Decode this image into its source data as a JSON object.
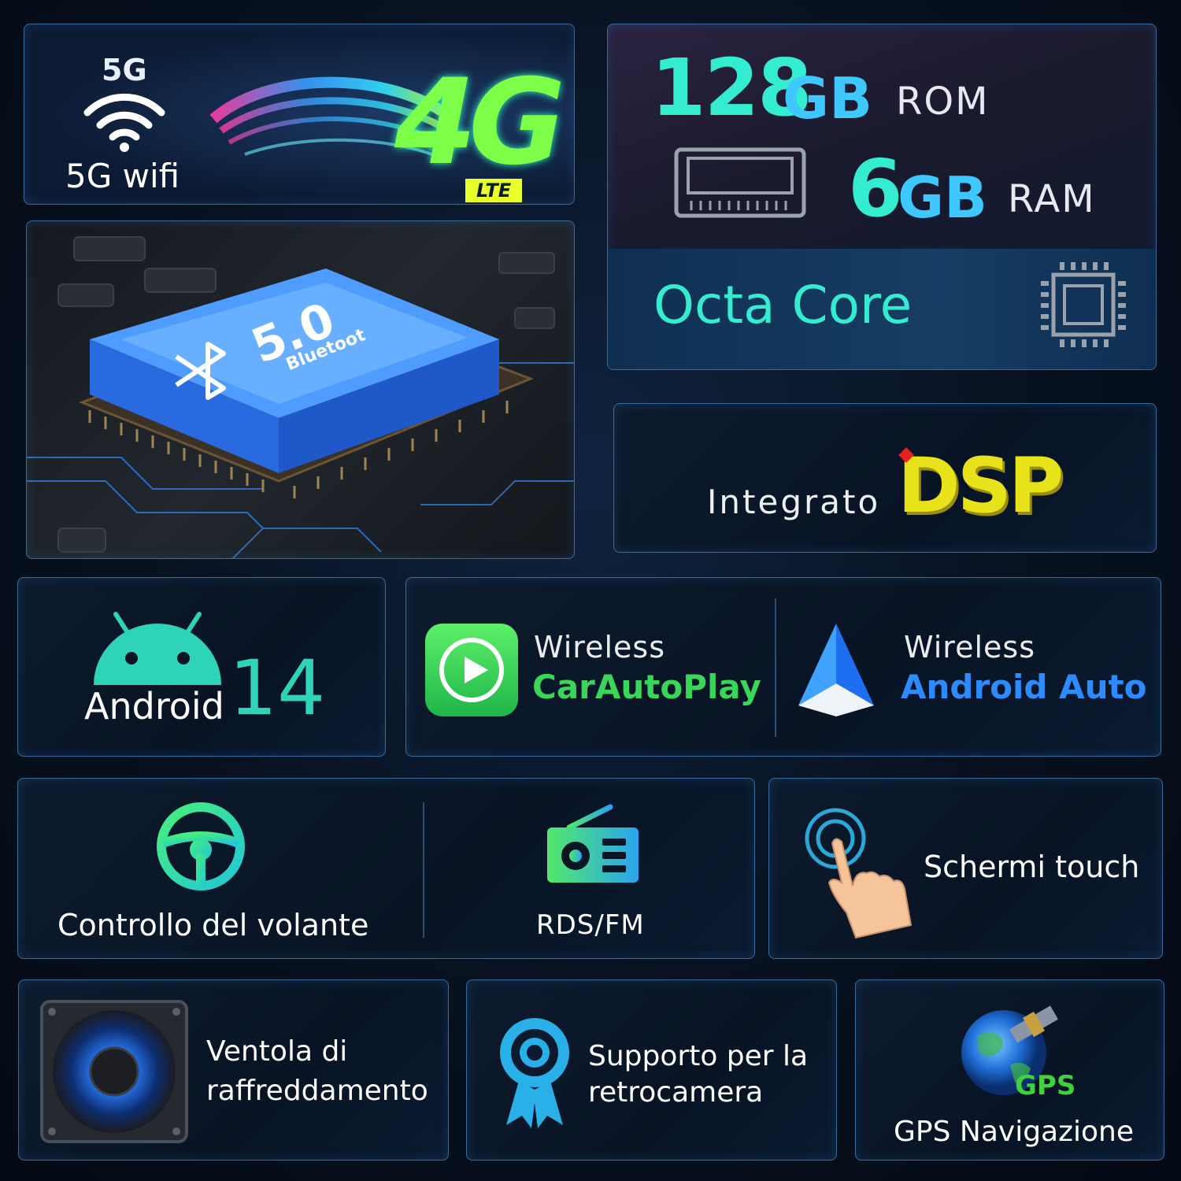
{
  "network": {
    "wifi_badge": "5G",
    "wifi_label": "5G wifi",
    "cellular": "4G",
    "cellular_badge": "LTE"
  },
  "memory": {
    "rom_value": "128",
    "rom_unit": "GB",
    "rom_label": "ROM",
    "ram_value": "6",
    "ram_unit": "GB",
    "ram_label": "RAM",
    "cpu_label": "Octa Core"
  },
  "bluetooth": {
    "version": "5.0",
    "label": "Bluetoot"
  },
  "dsp": {
    "prefix": "Integrato",
    "logo": "DSP"
  },
  "android": {
    "label": "Android",
    "version": "14"
  },
  "carplay": {
    "line1": "Wireless",
    "line2": "CarAutoPlay"
  },
  "android_auto": {
    "line1": "Wireless",
    "line2": "Android Auto"
  },
  "steering": {
    "label": "Controllo del volante"
  },
  "radio": {
    "label": "RDS/FM"
  },
  "touch": {
    "label": "Schermi touch"
  },
  "fan": {
    "line1": "Ventola di",
    "line2": "raffreddamento"
  },
  "camera": {
    "line1": "Supporto per la",
    "line2": "retrocamera"
  },
  "gps": {
    "badge": "GPS",
    "label": "GPS Navigazione"
  },
  "colors": {
    "accent_cyan": "#2de6d6",
    "carplay_green": "#34d058",
    "android_blue": "#2e8bff",
    "dsp_yellow": "#e8e21a"
  }
}
